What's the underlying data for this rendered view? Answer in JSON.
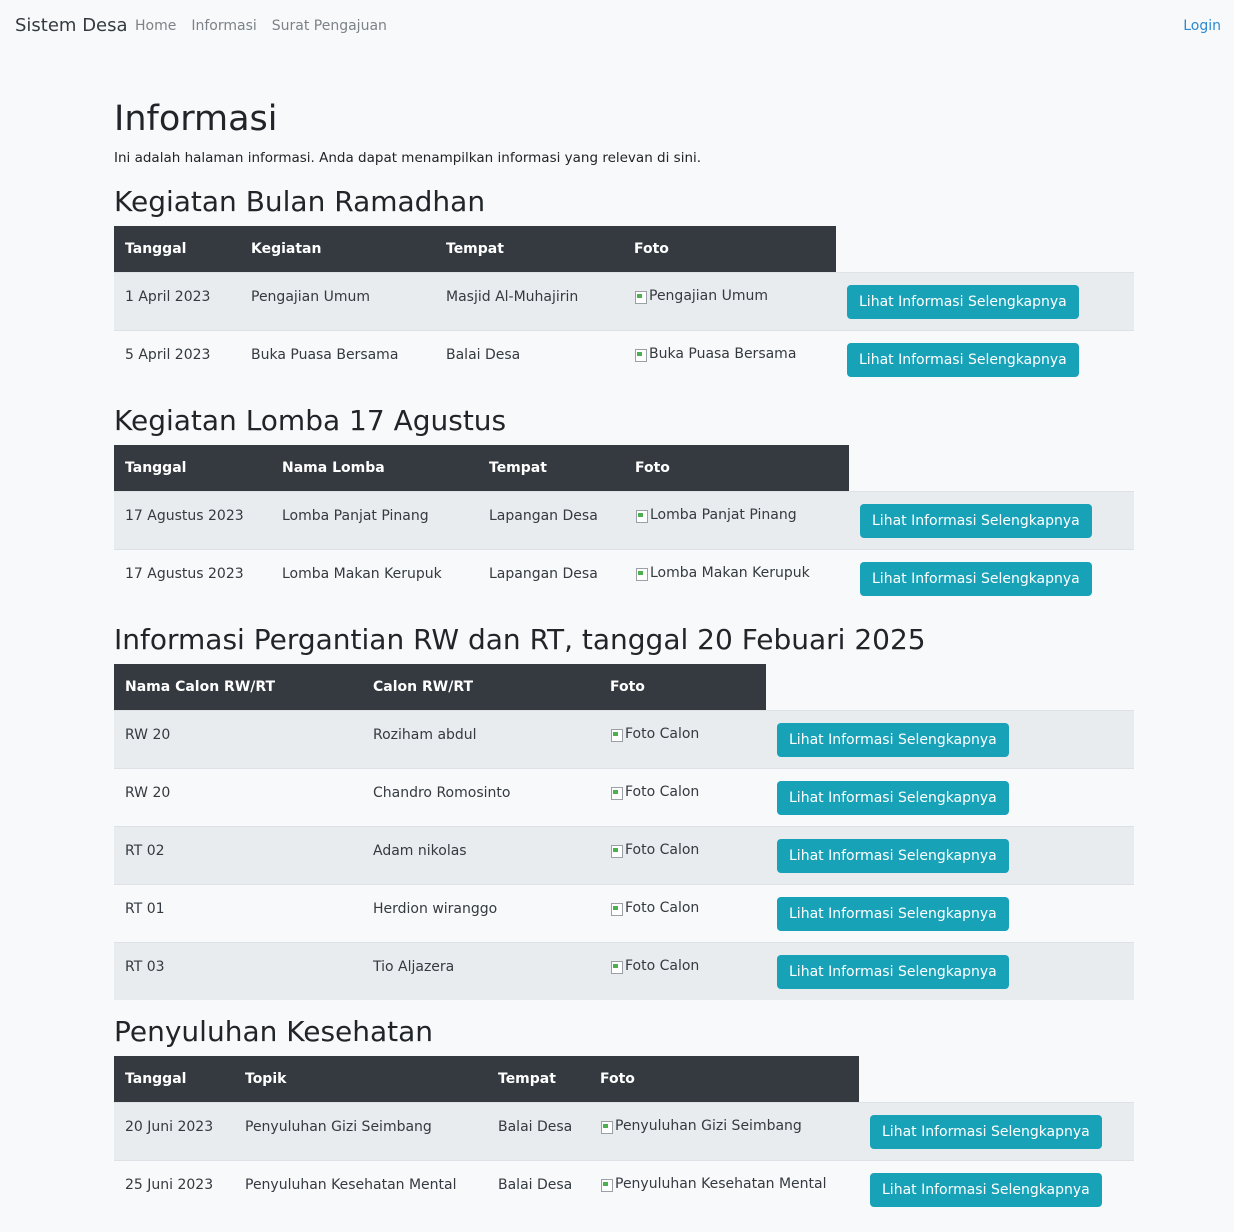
{
  "navbar": {
    "brand": "Sistem Desa",
    "links": [
      "Home",
      "Informasi",
      "Surat Pengajuan"
    ],
    "login": "Login"
  },
  "page": {
    "title": "Informasi",
    "description": "Ini adalah halaman informasi. Anda dapat menampilkan informasi yang relevan di sini."
  },
  "button_label": "Lihat Informasi Selengkapnya",
  "ramadhan": {
    "title": "Kegiatan Bulan Ramadhan",
    "headers": [
      "Tanggal",
      "Kegiatan",
      "Tempat",
      "Foto"
    ],
    "rows": [
      {
        "tanggal": "1 April 2023",
        "kegiatan": "Pengajian Umum",
        "tempat": "Masjid Al-Muhajirin",
        "foto": "Pengajian Umum"
      },
      {
        "tanggal": "5 April 2023",
        "kegiatan": "Buka Puasa Bersama",
        "tempat": "Balai Desa",
        "foto": "Buka Puasa Bersama"
      }
    ]
  },
  "lomba": {
    "title": "Kegiatan Lomba 17 Agustus",
    "headers": [
      "Tanggal",
      "Nama Lomba",
      "Tempat",
      "Foto"
    ],
    "rows": [
      {
        "tanggal": "17 Agustus 2023",
        "nama": "Lomba Panjat Pinang",
        "tempat": "Lapangan Desa",
        "foto": "Lomba Panjat Pinang"
      },
      {
        "tanggal": "17 Agustus 2023",
        "nama": "Lomba Makan Kerupuk",
        "tempat": "Lapangan Desa",
        "foto": "Lomba Makan Kerupuk"
      }
    ]
  },
  "rwrt": {
    "title": "Informasi Pergantian RW dan RT, tanggal 20 Febuari 2025",
    "headers": [
      "Nama Calon RW/RT",
      "Calon RW/RT",
      "Foto"
    ],
    "rows": [
      {
        "jabatan": "RW 20",
        "nama": "Roziham abdul",
        "foto": "Foto Calon"
      },
      {
        "jabatan": "RW 20",
        "nama": "Chandro Romosinto",
        "foto": "Foto Calon"
      },
      {
        "jabatan": "RT 02",
        "nama": "Adam nikolas",
        "foto": "Foto Calon"
      },
      {
        "jabatan": "RT 01",
        "nama": "Herdion wiranggo",
        "foto": "Foto Calon"
      },
      {
        "jabatan": "RT 03",
        "nama": "Tio Aljazera",
        "foto": "Foto Calon"
      }
    ]
  },
  "kesehatan": {
    "title": "Penyuluhan Kesehatan",
    "headers": [
      "Tanggal",
      "Topik",
      "Tempat",
      "Foto"
    ],
    "rows": [
      {
        "tanggal": "20 Juni 2023",
        "topik": "Penyuluhan Gizi Seimbang",
        "tempat": "Balai Desa",
        "foto": "Penyuluhan Gizi Seimbang"
      },
      {
        "tanggal": "25 Juni 2023",
        "topik": "Penyuluhan Kesehatan Mental",
        "tempat": "Balai Desa",
        "foto": "Penyuluhan Kesehatan Mental"
      }
    ]
  },
  "colors": {
    "header_bg": "#343a40",
    "button_bg": "#17a2b8",
    "stripe_bg": "#e9ecef",
    "page_bg": "#f8f9fa"
  }
}
